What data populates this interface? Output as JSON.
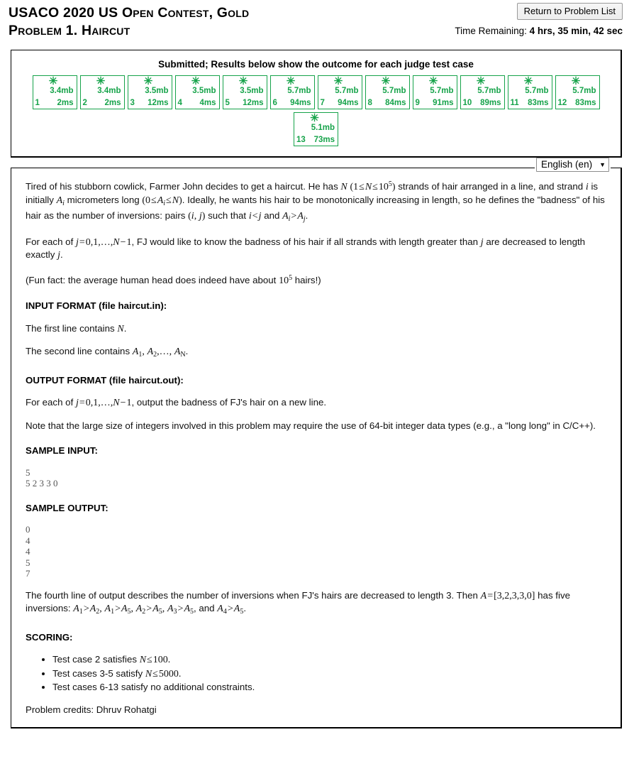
{
  "header": {
    "title_line1": "USACO 2020 US Open Contest, Gold",
    "title_line2": "Problem 1. Haircut",
    "return_button": "Return to Problem List",
    "time_label": "Time Remaining:",
    "time_value": "4 hrs, 35 min, 42 sec"
  },
  "results": {
    "title": "Submitted; Results below show the outcome for each judge test case",
    "accent_color": "#16a34a",
    "star_glyph": "✳",
    "cases": [
      {
        "num": "1",
        "mem": "3.4mb",
        "time": "2ms",
        "status": "pass"
      },
      {
        "num": "2",
        "mem": "3.4mb",
        "time": "2ms",
        "status": "pass"
      },
      {
        "num": "3",
        "mem": "3.5mb",
        "time": "12ms",
        "status": "pass"
      },
      {
        "num": "4",
        "mem": "3.5mb",
        "time": "4ms",
        "status": "pass"
      },
      {
        "num": "5",
        "mem": "3.5mb",
        "time": "12ms",
        "status": "pass"
      },
      {
        "num": "6",
        "mem": "5.7mb",
        "time": "94ms",
        "status": "pass"
      },
      {
        "num": "7",
        "mem": "5.7mb",
        "time": "94ms",
        "status": "pass"
      },
      {
        "num": "8",
        "mem": "5.7mb",
        "time": "84ms",
        "status": "pass"
      },
      {
        "num": "9",
        "mem": "5.7mb",
        "time": "91ms",
        "status": "pass"
      },
      {
        "num": "10",
        "mem": "5.7mb",
        "time": "89ms",
        "status": "pass"
      },
      {
        "num": "11",
        "mem": "5.7mb",
        "time": "83ms",
        "status": "pass"
      },
      {
        "num": "12",
        "mem": "5.7mb",
        "time": "83ms",
        "status": "pass"
      },
      {
        "num": "13",
        "mem": "5.1mb",
        "time": "73ms",
        "status": "pass"
      }
    ]
  },
  "language": {
    "selected": "English (en)",
    "caret": "▼",
    "options": [
      "English (en)"
    ]
  },
  "problem": {
    "para1_a": "Tired of his stubborn cowlick, Farmer John decides to get a haircut. He has ",
    "para1_b": " strands of hair arranged in a line, and strand ",
    "para1_c": " is initially ",
    "para1_d": " micrometers long ",
    "para1_e": ". Ideally, he wants his hair to be monotonically increasing in length, so he defines the \"badness\" of his hair as the number of inversions: pairs ",
    "para1_f": " such that ",
    "para1_g": " and ",
    "para1_h": ".",
    "para2_a": "For each of ",
    "para2_b": ", FJ would like to know the badness of his hair if all strands with length greater than ",
    "para2_c": " are decreased to length exactly ",
    "para2_d": ".",
    "para3_a": "(Fun fact: the average human head does indeed have about ",
    "para3_b": " hairs!)",
    "input_format_head": "INPUT FORMAT (file haircut.in):",
    "input_line1_a": "The first line contains ",
    "input_line1_b": ".",
    "input_line2_a": "The second line contains ",
    "input_line2_b": ".",
    "output_format_head": "OUTPUT FORMAT (file haircut.out):",
    "output_para_a": "For each of ",
    "output_para_b": ", output the badness of FJ's hair on a new line.",
    "note_para": "Note that the large size of integers involved in this problem may require the use of 64-bit integer data types (e.g., a \"long long\" in C/C++).",
    "sample_input_head": "SAMPLE INPUT:",
    "sample_input": "5\n5 2 3 3 0",
    "sample_output_head": "SAMPLE OUTPUT:",
    "sample_output": "0\n4\n4\n5\n7",
    "explain_a": "The fourth line of output describes the number of inversions when FJ's hairs are decreased to length 3. Then ",
    "explain_b": " has five inversions: ",
    "explain_c": ", and ",
    "explain_d": ".",
    "scoring_head": "SCORING:",
    "scoring_items": [
      "Test case 2 satisfies ",
      "Test cases 3-5 satisfy ",
      "Test cases 6-13 satisfy no additional constraints."
    ],
    "scoring_math": [
      "N ≤ 100.",
      "N ≤ 5000.",
      ""
    ],
    "credits": "Problem credits: Dhruv Rohatgi"
  }
}
